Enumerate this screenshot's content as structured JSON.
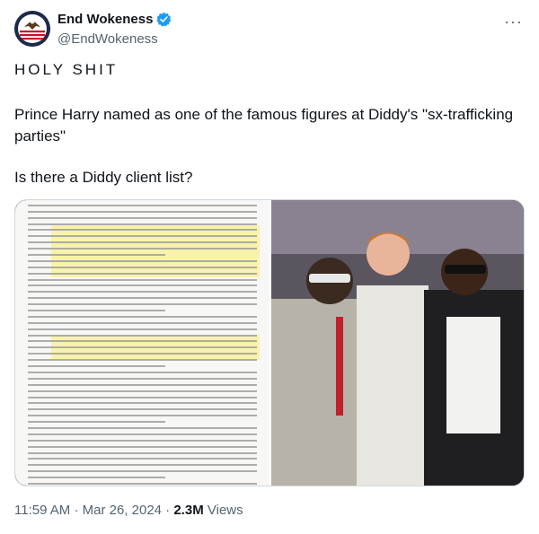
{
  "author": {
    "display_name": "End Wokeness",
    "handle": "@EndWokeness",
    "verified": true,
    "avatar_icon": "eagle-flag-avatar"
  },
  "menu_icon": "more-options-icon",
  "tweet": {
    "line1": "HOLY SHIT",
    "line2": "Prince Harry named as one of the famous figures at Diddy's \"sx-trafficking parties\"",
    "line3": "Is there a Diddy client list?"
  },
  "media": {
    "left": "legal-document-image",
    "right": "party-photo-image"
  },
  "meta": {
    "time": "11:59 AM",
    "sep1": "·",
    "date": "Mar 26, 2024",
    "sep2": "·",
    "views_count": "2.3M",
    "views_label": "Views"
  },
  "colors": {
    "text": "#0f1419",
    "secondary": "#536471",
    "verified": "#1d9bf0",
    "border": "#cfd9de"
  }
}
